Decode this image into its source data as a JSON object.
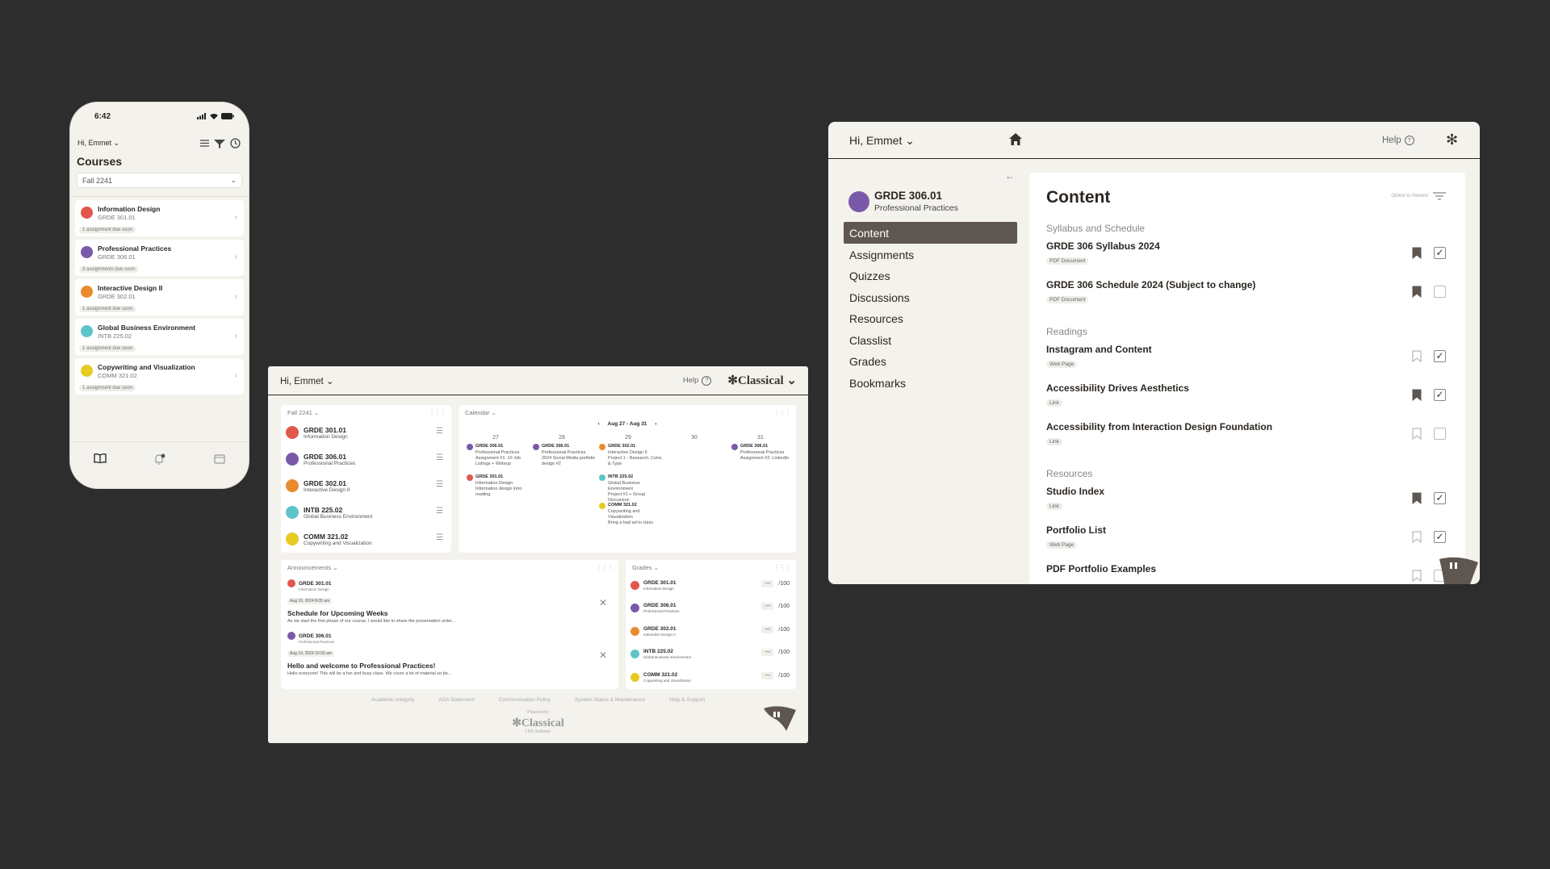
{
  "phone": {
    "time": "6:42",
    "greeting": "Hi, Emmet",
    "title": "Courses",
    "term": "Fall 2241",
    "courses": [
      {
        "name": "Information Design",
        "code": "GRDE 301.01",
        "badge": "1 assignment due soon",
        "color": "#e2574c"
      },
      {
        "name": "Professional Practices",
        "code": "GRDE 306.01",
        "badge": "3 assignments due soon",
        "color": "#7a5aa8"
      },
      {
        "name": "Interactive Design II",
        "code": "GRDE 302.01",
        "badge": "1 assignment due soon",
        "color": "#ea8a2e"
      },
      {
        "name": "Global Business Environment",
        "code": "INTB 225.02",
        "badge": "1 assignment due soon",
        "color": "#5fc4c8"
      },
      {
        "name": "Copywriting and Visualization",
        "code": "COMM 321.02",
        "badge": "1 assignment due soon",
        "color": "#e5cb22"
      }
    ]
  },
  "dashboard": {
    "greeting": "Hi, Emmet",
    "help": "Help",
    "logo": "Classical",
    "term": "Fall 2241",
    "calendar_title": "Calendar",
    "calendar_range": "Aug 27 - Aug 31",
    "days": [
      "27",
      "28",
      "29",
      "30",
      "31"
    ],
    "courses": [
      {
        "code": "GRDE 301.01",
        "name": "Information Design",
        "color": "#e2574c"
      },
      {
        "code": "GRDE 306.01",
        "name": "Professional Practices",
        "color": "#7a5aa8"
      },
      {
        "code": "GRDE 302.01",
        "name": "Interactive Design II",
        "color": "#ea8a2e"
      },
      {
        "code": "INTB 225.02",
        "name": "Global Business Environment",
        "color": "#5fc4c8"
      },
      {
        "code": "COMM 321.02",
        "name": "Copywriting and Visualization",
        "color": "#e5cb22"
      }
    ],
    "events": [
      {
        "code": "GRDE 306.01",
        "sub": "Professional Practices",
        "desc": "Assignment #1: 10 Job Listings + Writeup",
        "color": "#7a5aa8"
      },
      {
        "code": "GRDE 301.01",
        "sub": "Information Design",
        "desc": "Information design intro reading",
        "color": "#e2574c"
      },
      {
        "code": "GRDE 306.01",
        "sub": "Professional Practices",
        "desc": "2024 Social Media portfolio design #2",
        "color": "#7a5aa8"
      },
      {
        "code": "GRDE 302.01",
        "sub": "Interactive Design II",
        "desc": "Project 1 - Research, Color, & Type",
        "color": "#ea8a2e"
      },
      {
        "code": "INTB 225.02",
        "sub": "Global Business Environment",
        "desc": "Project #1 + Group Discussion",
        "color": "#5fc4c8"
      },
      {
        "code": "COMM 321.02",
        "sub": "Copywriting and Visualization",
        "desc": "Bring a bad ad to class",
        "color": "#e5cb22"
      },
      {
        "code": "GRDE 306.01",
        "sub": "Professional Practices",
        "desc": "Assignment #2: LinkedIn",
        "color": "#7a5aa8"
      }
    ],
    "announcements_title": "Announcements",
    "announcements": [
      {
        "code": "GRDE 301.01",
        "sub": "Information Design",
        "date": "Aug 16, 2024 8:05 am",
        "title": "Schedule for Upcoming Weeks",
        "body": "As we start the first phase of our course, I would like to share the presentation order...",
        "color": "#e2574c"
      },
      {
        "code": "GRDE 306.01",
        "sub": "Professional Practices",
        "date": "Aug 19, 2024 10:03 am",
        "title": "Hello and welcome to Professional Practices!",
        "body": "Hello everyone! This will be a fun and busy class. We cover a lot of material so be...",
        "color": "#7a5aa8"
      }
    ],
    "grades_title": "Grades",
    "grades": [
      {
        "code": "GRDE 301.01",
        "name": "Information Design",
        "score": "---",
        "max": "/100",
        "color": "#e2574c"
      },
      {
        "code": "GRDE 306.01",
        "name": "Professional Practices",
        "score": "---",
        "max": "/100",
        "color": "#7a5aa8"
      },
      {
        "code": "GRDE 302.01",
        "name": "Interactive Design II",
        "score": "---",
        "max": "/100",
        "color": "#ea8a2e"
      },
      {
        "code": "INTB 225.02",
        "name": "Global Business Environment",
        "score": "---",
        "max": "/100",
        "color": "#5fc4c8"
      },
      {
        "code": "COMM 321.02",
        "name": "Copywriting and Visualization",
        "score": "---",
        "max": "/100",
        "color": "#e5cb22"
      }
    ],
    "footer": [
      "Academic Integrity",
      "ADA Statement",
      "Communication Policy",
      "System Status & Maintenance",
      "Help & Support"
    ],
    "powered_by": "Powered by",
    "powered_logo": "Classical",
    "lms": "LMS Software"
  },
  "content": {
    "greeting": "Hi, Emmet",
    "help": "Help",
    "course_code": "GRDE 306.01",
    "course_name": "Professional Practices",
    "course_color": "#7a5aa8",
    "nav": [
      "Content",
      "Assignments",
      "Quizzes",
      "Discussions",
      "Resources",
      "Classlist",
      "Grades",
      "Bookmarks"
    ],
    "title": "Content",
    "sort": "Oldest to Newest",
    "sections": [
      {
        "title": "Syllabus and Schedule",
        "items": [
          {
            "title": "GRDE 306 Syllabus 2024",
            "type": "PDF Document",
            "bookmarked": true,
            "checked": true
          },
          {
            "title": "GRDE 306 Schedule 2024 (Subject to change)",
            "type": "PDF Document",
            "bookmarked": true,
            "checked": false
          }
        ]
      },
      {
        "title": "Readings",
        "items": [
          {
            "title": "Instagram and Content",
            "type": "Web Page",
            "bookmarked": false,
            "checked": true
          },
          {
            "title": "Accessibility Drives Aesthetics",
            "type": "Link",
            "bookmarked": true,
            "checked": true
          },
          {
            "title": "Accessibility from Interaction Design Foundation",
            "type": "Link",
            "bookmarked": false,
            "checked": false
          }
        ]
      },
      {
        "title": "Resources",
        "items": [
          {
            "title": "Studio Index",
            "type": "Link",
            "bookmarked": true,
            "checked": true
          },
          {
            "title": "Portfolio List",
            "type": "Web Page",
            "bookmarked": false,
            "checked": true
          },
          {
            "title": "PDF Portfolio Examples",
            "type": "",
            "bookmarked": false,
            "checked": false
          }
        ]
      }
    ]
  }
}
